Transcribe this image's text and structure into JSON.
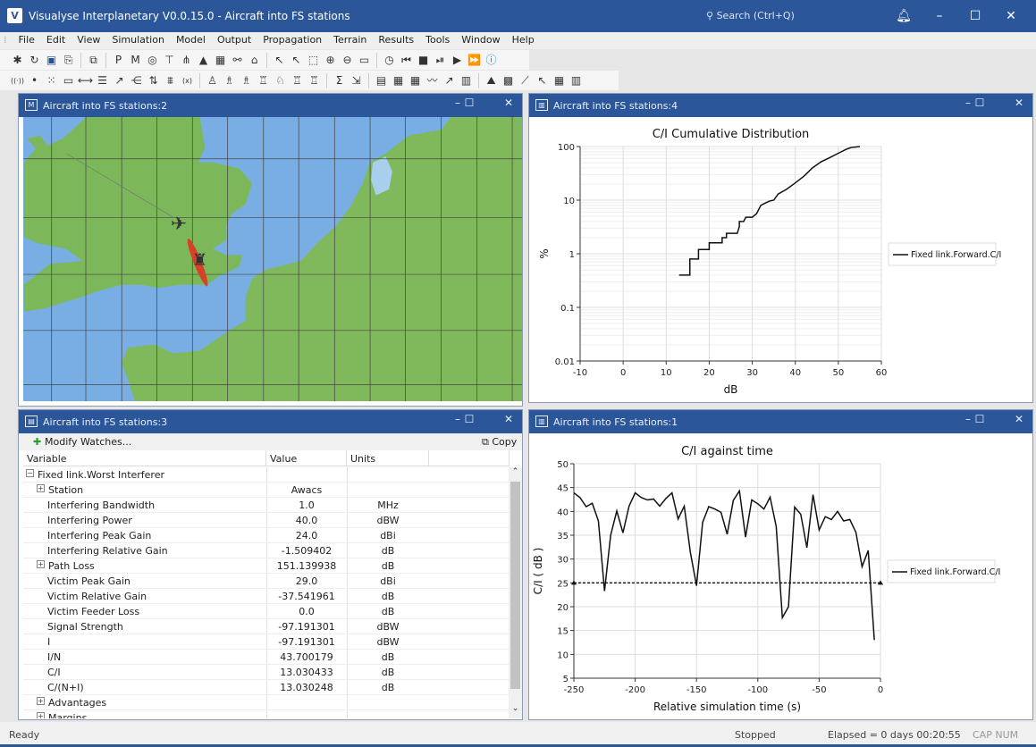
{
  "app": {
    "title": "Visualyse Interplanetary V0.0.15.0 - Aircraft into FS stations",
    "search_placeholder": "Search (Ctrl+Q)",
    "logo": "V"
  },
  "menu": [
    "File",
    "Edit",
    "View",
    "Simulation",
    "Model",
    "Output",
    "Propagation",
    "Terrain",
    "Results",
    "Tools",
    "Window",
    "Help"
  ],
  "toolbar1": [
    "new-icon",
    "open-icon",
    "save-icon",
    "save-as-icon",
    "|",
    "copy-icon",
    "|",
    "plot-p-icon",
    "plot-m-icon",
    "globe-view-icon",
    "tree-view-icon",
    "network-view-icon",
    "terrain-view-icon",
    "table-view-icon",
    "link-view-icon",
    "station-view-icon",
    "|",
    "pointer-icon",
    "select-icon",
    "zoom-rect-icon",
    "zoom-in-icon",
    "zoom-out-icon",
    "annotation-icon",
    "|",
    "clock-icon",
    "skip-start-icon",
    "stop-icon",
    "step-icon",
    "play-icon",
    "fast-forward-icon",
    "info-icon"
  ],
  "toolbar1_glyphs": [
    "✱",
    "↻",
    "▣",
    "⎘",
    "|",
    "⧉",
    "|",
    "P",
    "M",
    "◎",
    "⊤",
    "⋔",
    "▲",
    "▦",
    "⚯",
    "⌂",
    "|",
    "↖",
    "↖",
    "⬚",
    "⊕",
    "⊖",
    "▭",
    "|",
    "◷",
    "⏮",
    "■",
    "⏯",
    "▶",
    "⏩",
    "ⓘ"
  ],
  "toolbar2": [
    "antenna-icon",
    "point-icon",
    "scatter-icon",
    "beam-icon",
    "link-icon",
    "ladder-icon",
    "vector-icon",
    "share-icon",
    "swap-icon",
    "group-icon",
    "variables-icon",
    "|",
    "station-a-icon",
    "station-b-icon",
    "station-c-icon",
    "station-d-icon",
    "station-e-icon",
    "station-f-icon",
    "station-g-icon",
    "|",
    "sum-icon",
    "export-icon",
    "|",
    "watch-icon",
    "area-icon",
    "area2-icon",
    "chart-line-icon",
    "chart-trend-icon",
    "chart-bar-icon",
    "|",
    "terrain-icon",
    "terrain2-icon",
    "route-icon",
    "cursor-route-icon",
    "building-icon",
    "building2-icon"
  ],
  "toolbar2_glyphs": [
    "((·))",
    "•",
    "⁙",
    "▭",
    "⟷",
    "☰",
    "↗",
    "⋲",
    "⇅",
    "⩩",
    "(x)",
    "|",
    "♙",
    "♗",
    "♗",
    "♖",
    "♘",
    "♖",
    "♖",
    "|",
    "Σ",
    "⇲",
    "|",
    "▤",
    "▦",
    "▦",
    "〰",
    "↗",
    "▥",
    "|",
    "⛰",
    "▩",
    "⟋",
    "↖",
    "▦",
    "▥"
  ],
  "windows": {
    "map": {
      "title": "Aircraft into FS stations:2",
      "icon": "M"
    },
    "cdf": {
      "title": "Aircraft into FS stations:4"
    },
    "watch": {
      "title": "Aircraft into FS stations:3",
      "modify": "Modify Watches...",
      "copy": "Copy",
      "columns": [
        "Variable",
        "Value",
        "Units"
      ],
      "rows": [
        {
          "label": "Fixed link.Worst Interferer",
          "value": "",
          "units": "",
          "level": 0,
          "expander": "−"
        },
        {
          "label": "Station",
          "value": "Awacs",
          "units": "",
          "level": 1,
          "expander": "+"
        },
        {
          "label": "Interfering Bandwidth",
          "value": "1.0",
          "units": "MHz",
          "level": 2
        },
        {
          "label": "Interfering Power",
          "value": "40.0",
          "units": "dBW",
          "level": 2
        },
        {
          "label": "Interfering Peak Gain",
          "value": "24.0",
          "units": "dBi",
          "level": 2
        },
        {
          "label": "Interfering Relative Gain",
          "value": "-1.509402",
          "units": "dB",
          "level": 2
        },
        {
          "label": "Path Loss",
          "value": "151.139938",
          "units": "dB",
          "level": 1,
          "expander": "+"
        },
        {
          "label": "Victim Peak Gain",
          "value": "29.0",
          "units": "dBi",
          "level": 2
        },
        {
          "label": "Victim Relative Gain",
          "value": "-37.541961",
          "units": "dB",
          "level": 2
        },
        {
          "label": "Victim Feeder Loss",
          "value": "0.0",
          "units": "dB",
          "level": 2
        },
        {
          "label": "Signal Strength",
          "value": "-97.191301",
          "units": "dBW",
          "level": 2
        },
        {
          "label": "I",
          "value": "-97.191301",
          "units": "dBW",
          "level": 2
        },
        {
          "label": "I/N",
          "value": "43.700179",
          "units": "dB",
          "level": 2
        },
        {
          "label": "C/I",
          "value": "13.030433",
          "units": "dB",
          "level": 2
        },
        {
          "label": "C/(N+I)",
          "value": "13.030248",
          "units": "dB",
          "level": 2
        },
        {
          "label": "Advantages",
          "value": "",
          "units": "",
          "level": 1,
          "expander": "+"
        },
        {
          "label": "Margins",
          "value": "",
          "units": "",
          "level": 1,
          "expander": "+"
        }
      ]
    },
    "time": {
      "title": "Aircraft into FS stations:1"
    }
  },
  "status": {
    "left": "Ready",
    "state": "Stopped",
    "elapsed": "Elapsed = 0 days 00:20:55",
    "indicators": "CAP NUM"
  },
  "colors": {
    "titlebar": "#2b579a",
    "map_sea": "#78aee3",
    "map_land": "#7cb85a",
    "beam": "#d9402a"
  },
  "chart_data": [
    {
      "type": "line",
      "title": "C/I Cumulative Distribution",
      "xlabel": "dB",
      "ylabel": "%",
      "xlim": [
        -10,
        60
      ],
      "ylim": [
        0.01,
        100
      ],
      "yscale": "log",
      "grid": true,
      "legend": "right",
      "xticks": [
        "-10",
        "0",
        "10",
        "20",
        "30",
        "40",
        "50",
        "60"
      ],
      "yticks": [
        "0.01",
        "0.1",
        "1",
        "10",
        "100"
      ],
      "series": [
        {
          "name": "Fixed link.Forward.C/I",
          "x": [
            13,
            15.5,
            15.5,
            17.5,
            17.5,
            20,
            20,
            23,
            23,
            24,
            24,
            26.5,
            27,
            27,
            28,
            28.5,
            30,
            31,
            32,
            33,
            34,
            35,
            36,
            38,
            40,
            42,
            44,
            46,
            48,
            50,
            52,
            53,
            55
          ],
          "y": [
            0.4,
            0.4,
            0.8,
            0.8,
            1.2,
            1.2,
            1.6,
            1.6,
            2,
            2,
            2.4,
            2.4,
            3.2,
            4,
            4,
            4.8,
            4.8,
            5.6,
            8,
            8.8,
            9.6,
            10,
            13,
            16,
            21,
            28,
            40,
            52,
            62,
            75,
            90,
            96,
            100
          ]
        }
      ]
    },
    {
      "type": "line",
      "title": "C/I against time",
      "xlabel": "Relative simulation time (s)",
      "ylabel": "C/I ( dB )",
      "xlim": [
        -250,
        0
      ],
      "ylim": [
        5,
        50
      ],
      "grid": true,
      "legend": "right",
      "xticks": [
        "-250",
        "-200",
        "-150",
        "-100",
        "-50",
        "0"
      ],
      "yticks": [
        "5",
        "10",
        "15",
        "20",
        "25",
        "30",
        "35",
        "40",
        "45",
        "50"
      ],
      "threshold": 25,
      "series": [
        {
          "name": "Fixed link.Forward.C/I",
          "x": [
            -250,
            -245,
            -240,
            -235,
            -230,
            -225,
            -220,
            -215,
            -210,
            -205,
            -200,
            -195,
            -190,
            -185,
            -180,
            -175,
            -170,
            -165,
            -160,
            -155,
            -150,
            -145,
            -140,
            -135,
            -130,
            -125,
            -120,
            -115,
            -110,
            -105,
            -100,
            -95,
            -90,
            -85,
            -80,
            -75,
            -70,
            -65,
            -60,
            -55,
            -50,
            -45,
            -40,
            -35,
            -30,
            -25,
            -20,
            -15,
            -10,
            -5
          ],
          "y": [
            43.9,
            42.9,
            41.0,
            41.7,
            38.0,
            23.3,
            35.0,
            40.1,
            35.5,
            41.1,
            43.9,
            42.9,
            42.4,
            42.6,
            41.1,
            42.7,
            43.9,
            38.4,
            41.1,
            31.4,
            24.4,
            37.7,
            41.0,
            40.5,
            39.8,
            35.2,
            42.3,
            44.3,
            34.6,
            42.4,
            41.6,
            40.5,
            43.0,
            36.8,
            17.7,
            20.0,
            40.9,
            39.4,
            32.4,
            43.5,
            36.1,
            38.9,
            38.3,
            40.0,
            38.0,
            38.3,
            35.6,
            28.4,
            31.8,
            13.0
          ]
        }
      ]
    }
  ]
}
